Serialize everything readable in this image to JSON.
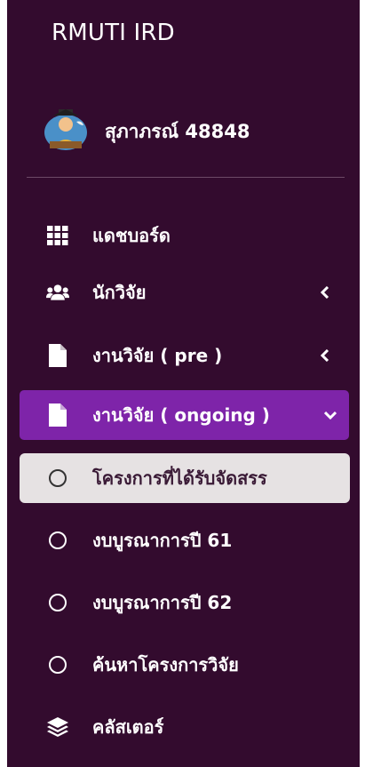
{
  "brand": {
    "title": "RMUTI IRD"
  },
  "user": {
    "name": "สุภาภรณ์ 48848"
  },
  "colors": {
    "sidebar_bg": "#330b2e",
    "active_bg": "#7e24a9",
    "selected_bg": "#e6e2e3"
  },
  "nav": {
    "items": [
      {
        "label": "แดชบอร์ด",
        "icon": "grid-icon"
      },
      {
        "label": "นักวิจัย",
        "icon": "users-icon",
        "chevron": "chevron-left-icon"
      },
      {
        "label": "งานวิจัย ( pre )",
        "icon": "file-icon",
        "chevron": "chevron-left-icon"
      },
      {
        "label": "งานวิจัย ( ongoing )",
        "icon": "file-icon",
        "chevron": "chevron-down-icon",
        "active": true
      }
    ],
    "subitems": [
      {
        "label": "โครงการที่ได้รับจัดสรร",
        "icon": "circle-icon",
        "selected": true
      },
      {
        "label": "งบบูรณาการปี 61",
        "icon": "circle-icon"
      },
      {
        "label": "งบบูรณาการปี 62",
        "icon": "circle-icon"
      },
      {
        "label": "ค้นหาโครงการวิจัย",
        "icon": "circle-icon"
      }
    ],
    "bottom_items": [
      {
        "label": "คลัสเตอร์",
        "icon": "layers-icon"
      }
    ]
  }
}
